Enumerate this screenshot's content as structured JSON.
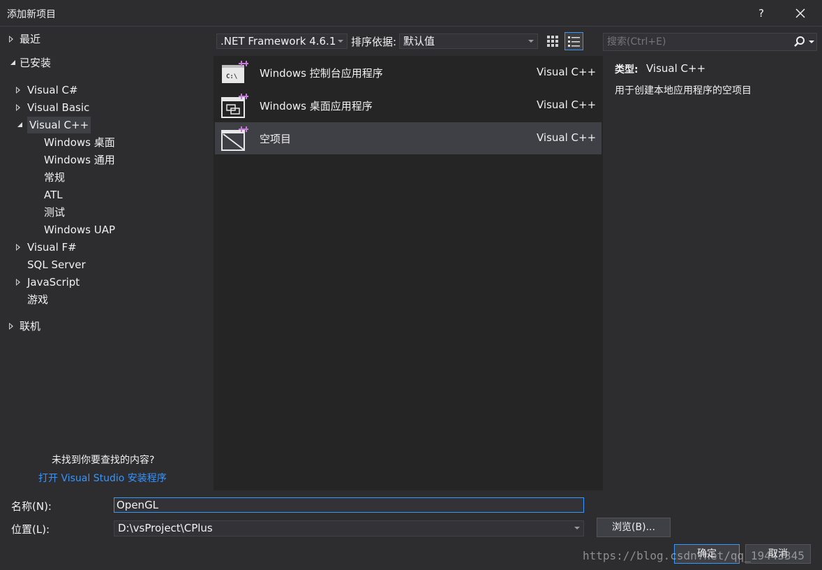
{
  "window": {
    "title": "添加新项目",
    "help_label": "?",
    "close_label": "✕"
  },
  "sidebar": {
    "recent": "最近",
    "installed": "已安装",
    "items": [
      {
        "label": "Visual C#",
        "expand": "collapsed"
      },
      {
        "label": "Visual Basic",
        "expand": "collapsed"
      },
      {
        "label": "Visual C++",
        "expand": "expanded",
        "selected": true
      },
      {
        "label": "Windows 桌面"
      },
      {
        "label": "Windows 通用"
      },
      {
        "label": "常规"
      },
      {
        "label": "ATL"
      },
      {
        "label": "测试"
      },
      {
        "label": "Windows UAP"
      },
      {
        "label": "Visual F#",
        "expand": "collapsed"
      },
      {
        "label": "SQL Server"
      },
      {
        "label": "JavaScript",
        "expand": "collapsed"
      },
      {
        "label": "游戏"
      }
    ],
    "online": "联机",
    "not_found_text": "未找到你要查找的内容?",
    "installer_link": "打开 Visual Studio 安装程序"
  },
  "toolbar": {
    "framework": ".NET Framework 4.6.1",
    "sort_label": "排序依据:",
    "sort_value": "默认值",
    "search_placeholder": "搜索(Ctrl+E)",
    "icons": {
      "grid": "grid-view-icon",
      "list": "list-view-icon",
      "search": "search-icon"
    }
  },
  "templates": [
    {
      "name": "Windows 控制台应用程序",
      "language": "Visual C++",
      "icon": "console-app-icon"
    },
    {
      "name": "Windows 桌面应用程序",
      "language": "Visual C++",
      "icon": "desktop-app-icon"
    },
    {
      "name": "空项目",
      "language": "Visual C++",
      "icon": "empty-project-icon",
      "selected": true
    }
  ],
  "details": {
    "type_label": "类型:",
    "type_value": "Visual C++",
    "description": "用于创建本地应用程序的空项目"
  },
  "form": {
    "name_label": "名称(N):",
    "name_value": "OpenGL",
    "location_label": "位置(L):",
    "location_value": "D:\\vsProject\\CPlus",
    "browse_label": "浏览(B)...",
    "ok_label": "确定",
    "cancel_label": "取消"
  },
  "watermark": "https://blog.csdn.net/qq_19443345",
  "colors": {
    "background": "#2d2d30",
    "list_background": "#252526",
    "selection": "#3f3f46",
    "accent": "#3399ff",
    "link": "#3794ff",
    "icon_plus": "#c27cd8"
  }
}
